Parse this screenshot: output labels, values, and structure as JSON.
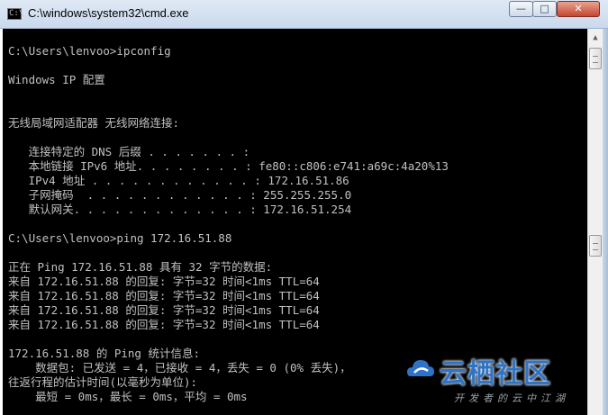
{
  "window": {
    "title": "C:\\windows\\system32\\cmd.exe",
    "icon_name": "cmd-icon",
    "icon_text": "C:\\",
    "controls": {
      "minimize": "—",
      "maximize": "□",
      "close": "✕"
    }
  },
  "console": {
    "text_color": "#c0c0c0",
    "background": "#000000",
    "lines": [
      "C:\\Users\\lenvoo>ipconfig",
      "",
      "Windows IP 配置",
      "",
      "",
      "无线局域网适配器 无线网络连接:",
      "",
      "   连接特定的 DNS 后缀 . . . . . . . :",
      "   本地链接 IPv6 地址. . . . . . . . : fe80::c806:e741:a69c:4a20%13",
      "   IPv4 地址 . . . . . . . . . . . . : 172.16.51.86",
      "   子网掩码  . . . . . . . . . . . . : 255.255.255.0",
      "   默认网关. . . . . . . . . . . . . : 172.16.51.254",
      "",
      "C:\\Users\\lenvoo>ping 172.16.51.88",
      "",
      "正在 Ping 172.16.51.88 具有 32 字节的数据:",
      "来自 172.16.51.88 的回复: 字节=32 时间<1ms TTL=64",
      "来自 172.16.51.88 的回复: 字节=32 时间<1ms TTL=64",
      "来自 172.16.51.88 的回复: 字节=32 时间<1ms TTL=64",
      "来自 172.16.51.88 的回复: 字节=32 时间<1ms TTL=64",
      "",
      "172.16.51.88 的 Ping 统计信息:",
      "    数据包: 已发送 = 4，已接收 = 4，丢失 = 0 (0% 丢失)，",
      "往返行程的估计时间(以毫秒为单位):",
      "    最短 = 0ms，最长 = 0ms，平均 = 0ms"
    ]
  },
  "scrollbar": {
    "up_arrow": "▲"
  },
  "watermark": {
    "title": "云栖社区",
    "subtitle": "开发者的云中江湖",
    "color": "#2f73c6"
  }
}
